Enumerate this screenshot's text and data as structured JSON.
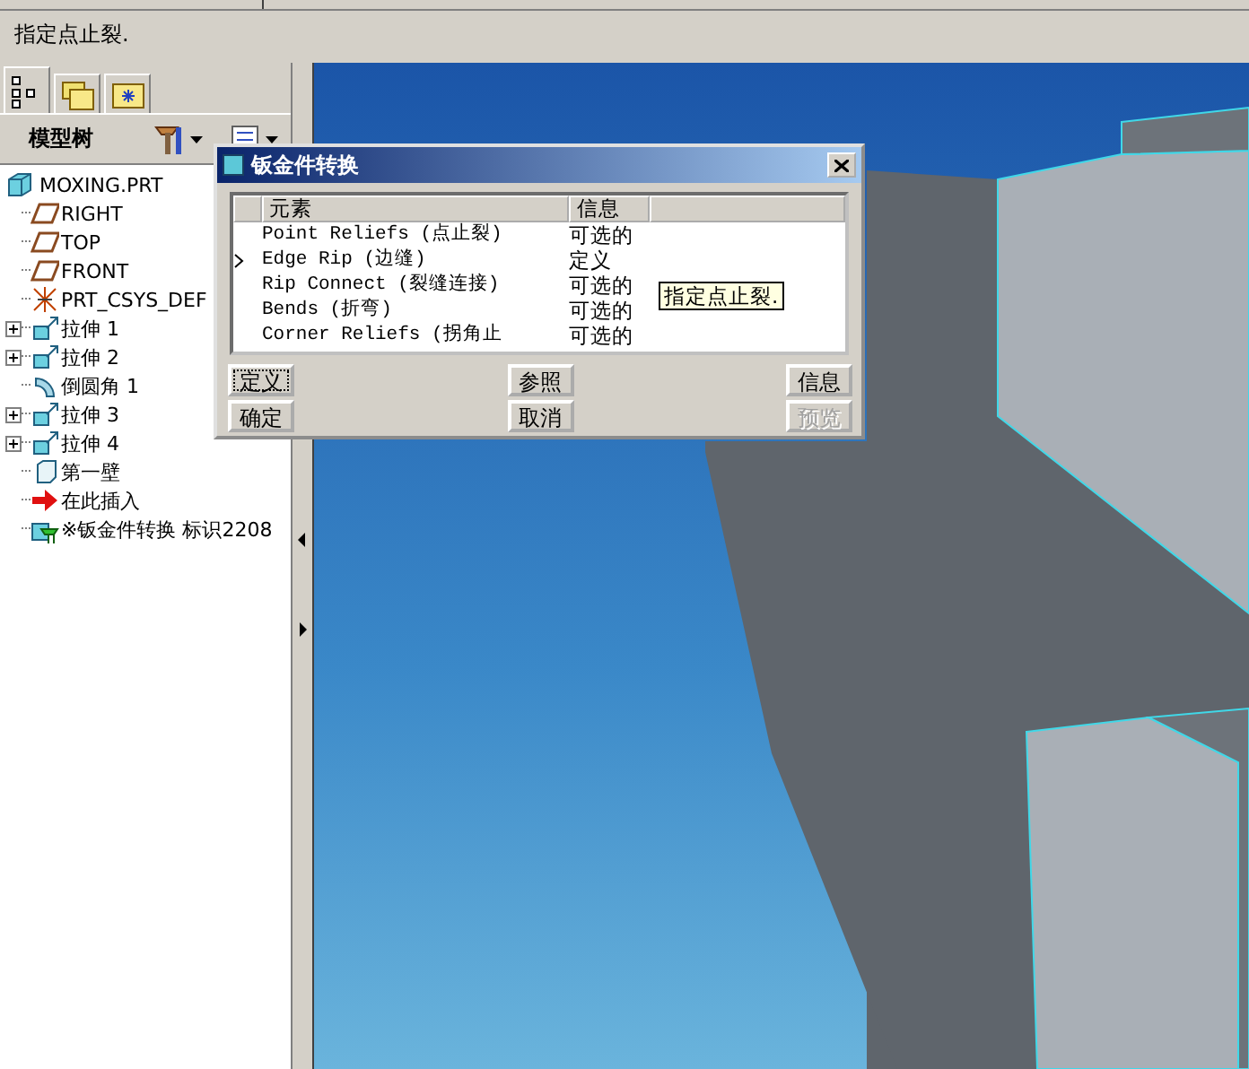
{
  "message": "指定点止裂.",
  "model_panel": {
    "tabs": [
      {
        "kind": "tree",
        "selected": true
      },
      {
        "kind": "folders",
        "selected": false
      },
      {
        "kind": "favorites",
        "selected": false
      }
    ],
    "title": "模型树",
    "tree": {
      "label": "MOXING.PRT",
      "kind": "part",
      "children": [
        {
          "label": "RIGHT",
          "kind": "plane",
          "expandable": false
        },
        {
          "label": "TOP",
          "kind": "plane",
          "expandable": false
        },
        {
          "label": "FRONT",
          "kind": "plane",
          "expandable": false
        },
        {
          "label": "PRT_CSYS_DEF",
          "kind": "csys",
          "expandable": false
        },
        {
          "label": "拉伸 1",
          "kind": "extrude",
          "expandable": true
        },
        {
          "label": "拉伸 2",
          "kind": "extrude",
          "expandable": true
        },
        {
          "label": "倒圆角 1",
          "kind": "round",
          "expandable": false
        },
        {
          "label": "拉伸 3",
          "kind": "extrude",
          "expandable": true
        },
        {
          "label": "拉伸 4",
          "kind": "extrude",
          "expandable": true
        },
        {
          "label": "第一壁",
          "kind": "wall",
          "expandable": false
        },
        {
          "label": "在此插入",
          "kind": "insert",
          "expandable": false
        },
        {
          "label": "※钣金件转换 标识2208",
          "kind": "convert",
          "expandable": false
        }
      ]
    }
  },
  "dialog": {
    "title": "钣金件转换",
    "columns": [
      "元素",
      "信息"
    ],
    "rows": [
      {
        "element": "Point Reliefs (点止裂)",
        "info": "可选的",
        "selected": false
      },
      {
        "element": "Edge Rip (边缝)",
        "info": "定义",
        "selected": true
      },
      {
        "element": "Rip Connect (裂缝连接)",
        "info": "可选的",
        "selected": false
      },
      {
        "element": "Bends (折弯)",
        "info": "可选的",
        "selected": false
      },
      {
        "element": "Corner Reliefs (拐角止",
        "info": "可选的",
        "selected": false
      }
    ],
    "button_columns": [
      [
        {
          "label": "定义",
          "focused": true,
          "disabled": false
        },
        {
          "label": "确定",
          "focused": false,
          "disabled": false
        }
      ],
      [
        {
          "label": "参照",
          "focused": false,
          "disabled": false
        },
        {
          "label": "取消",
          "focused": false,
          "disabled": false
        }
      ],
      [
        {
          "label": "信息",
          "focused": false,
          "disabled": false
        },
        {
          "label": "预览",
          "focused": false,
          "disabled": true
        }
      ]
    ],
    "tooltip": "指定点止裂."
  }
}
